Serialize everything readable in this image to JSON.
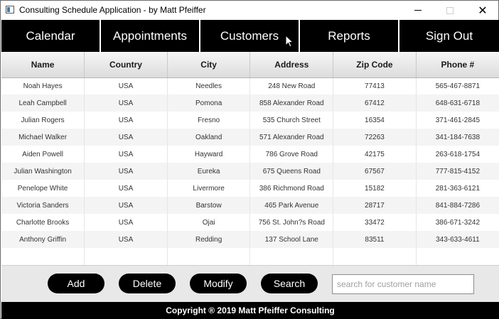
{
  "window": {
    "title": "Consulting Schedule Application - by Matt Pfeiffer",
    "controls": {
      "minimize": "—",
      "maximize": "☐",
      "close": "✕"
    }
  },
  "nav": {
    "items": [
      "Calendar",
      "Appointments",
      "Customers",
      "Reports",
      "Sign Out"
    ]
  },
  "table": {
    "columns": [
      "Name",
      "Country",
      "City",
      "Address",
      "Zip Code",
      "Phone #"
    ],
    "rows": [
      [
        "Noah Hayes",
        "USA",
        "Needles",
        "248 New Road",
        "77413",
        "565-467-8871"
      ],
      [
        "Leah Campbell",
        "USA",
        "Pomona",
        "858 Alexander Road",
        "67412",
        "648-631-6718"
      ],
      [
        "Julian Rogers",
        "USA",
        "Fresno",
        "535 Church Street",
        "16354",
        "371-461-2845"
      ],
      [
        "Michael Walker",
        "USA",
        "Oakland",
        "571 Alexander Road",
        "72263",
        "341-184-7638"
      ],
      [
        "Aiden Powell",
        "USA",
        "Hayward",
        "786 Grove Road",
        "42175",
        "263-618-1754"
      ],
      [
        "Julian Washington",
        "USA",
        "Eureka",
        "675 Queens Road",
        "67567",
        "777-815-4152"
      ],
      [
        "Penelope White",
        "USA",
        "Livermore",
        "386 Richmond Road",
        "15182",
        "281-363-6121"
      ],
      [
        "Victoria Sanders",
        "USA",
        "Barstow",
        "465 Park Avenue",
        "28717",
        "841-884-7286"
      ],
      [
        "Charlotte Brooks",
        "USA",
        "Ojai",
        "756 St. John?s Road",
        "33472",
        "386-671-3242"
      ],
      [
        "Anthony Griffin",
        "USA",
        "Redding",
        "137 School Lane",
        "83511",
        "343-633-4611"
      ]
    ]
  },
  "actions": {
    "add": "Add",
    "delete": "Delete",
    "modify": "Modify",
    "search": "Search"
  },
  "search": {
    "placeholder": "search for customer name",
    "value": ""
  },
  "footer": {
    "text": "Copyright ® 2019 Matt Pfeiffer Consulting"
  },
  "icons": {
    "app": "app-window-icon",
    "cursor": "mouse-pointer-icon"
  }
}
